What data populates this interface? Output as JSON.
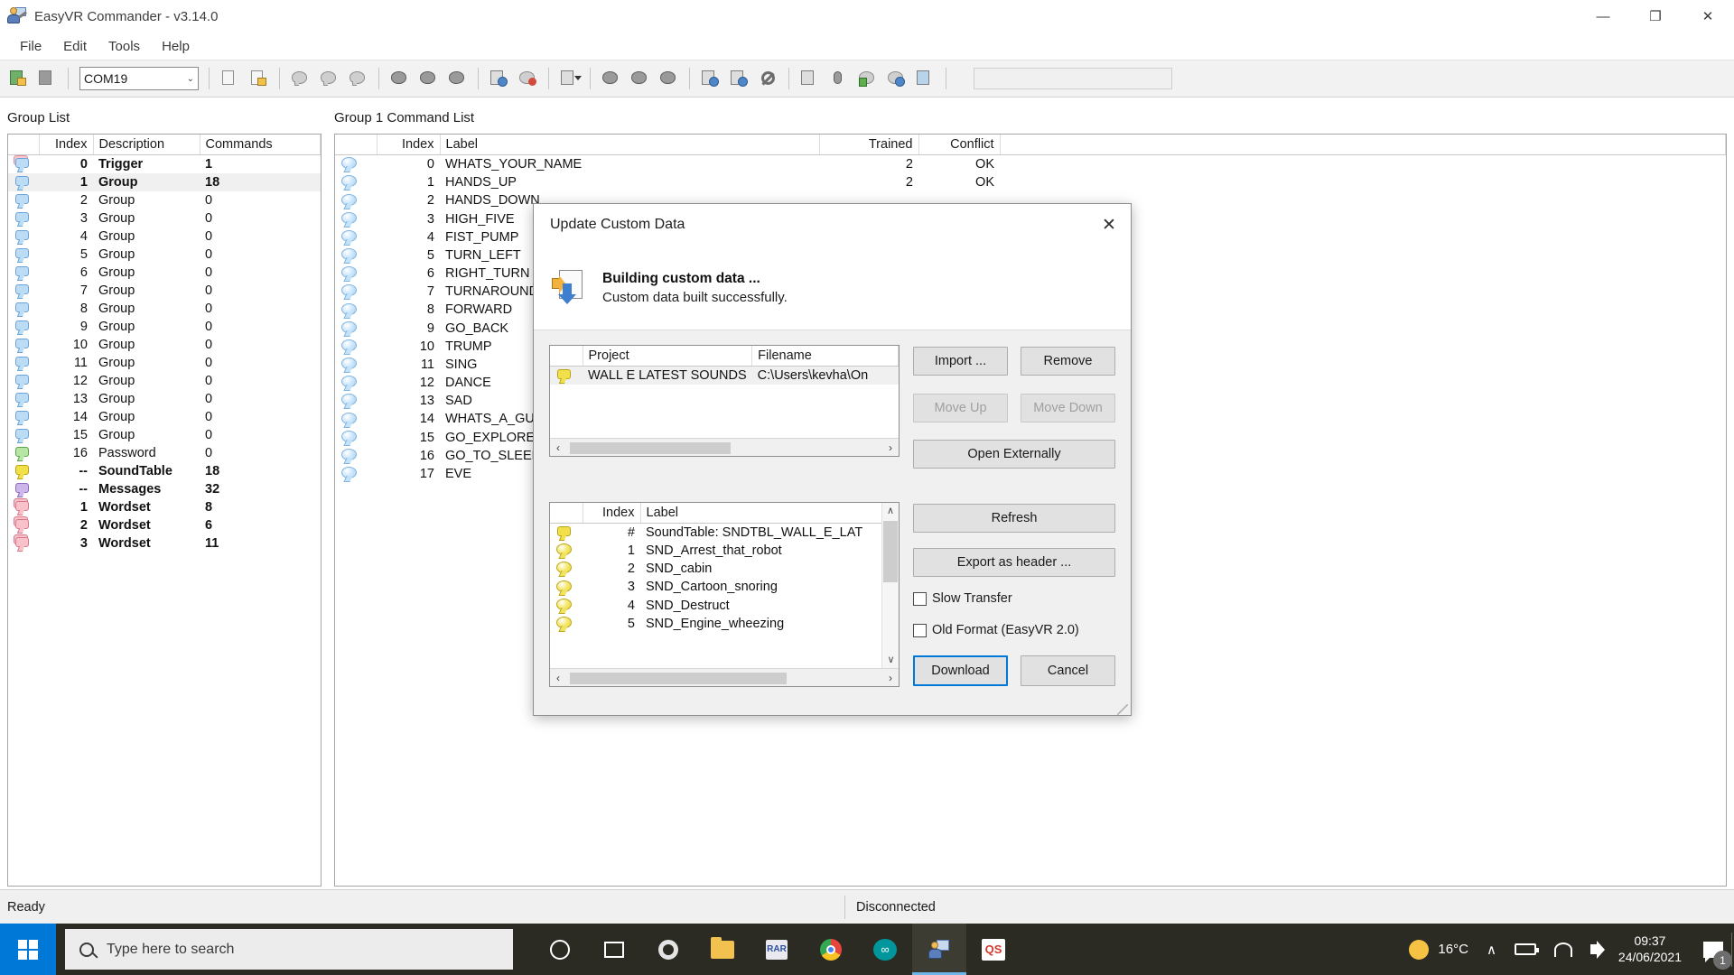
{
  "window": {
    "title": "EasyVR Commander - v3.14.0",
    "icon": "app-icon",
    "minimize": "—",
    "maximize": "❐",
    "close": "✕"
  },
  "menu": {
    "items": [
      "File",
      "Edit",
      "Tools",
      "Help"
    ]
  },
  "toolbar": {
    "port_value": "COM19",
    "port_carat": "⌄",
    "text_field_value": ""
  },
  "group_list": {
    "header": "Group List",
    "columns": [
      "",
      "Index",
      "Description",
      "Commands"
    ],
    "rows": [
      {
        "index": "0",
        "description": "Trigger",
        "commands": "1",
        "icon": "bubble-pink-stack",
        "bold": true,
        "selected": false
      },
      {
        "index": "1",
        "description": "Group",
        "commands": "18",
        "icon": "bubble-blue",
        "bold": true,
        "selected": true
      },
      {
        "index": "2",
        "description": "Group",
        "commands": "0",
        "icon": "bubble-blue",
        "bold": false,
        "selected": false
      },
      {
        "index": "3",
        "description": "Group",
        "commands": "0",
        "icon": "bubble-blue",
        "bold": false,
        "selected": false
      },
      {
        "index": "4",
        "description": "Group",
        "commands": "0",
        "icon": "bubble-blue",
        "bold": false,
        "selected": false
      },
      {
        "index": "5",
        "description": "Group",
        "commands": "0",
        "icon": "bubble-blue",
        "bold": false,
        "selected": false
      },
      {
        "index": "6",
        "description": "Group",
        "commands": "0",
        "icon": "bubble-blue",
        "bold": false,
        "selected": false
      },
      {
        "index": "7",
        "description": "Group",
        "commands": "0",
        "icon": "bubble-blue",
        "bold": false,
        "selected": false
      },
      {
        "index": "8",
        "description": "Group",
        "commands": "0",
        "icon": "bubble-blue",
        "bold": false,
        "selected": false
      },
      {
        "index": "9",
        "description": "Group",
        "commands": "0",
        "icon": "bubble-blue",
        "bold": false,
        "selected": false
      },
      {
        "index": "10",
        "description": "Group",
        "commands": "0",
        "icon": "bubble-blue",
        "bold": false,
        "selected": false
      },
      {
        "index": "11",
        "description": "Group",
        "commands": "0",
        "icon": "bubble-blue",
        "bold": false,
        "selected": false
      },
      {
        "index": "12",
        "description": "Group",
        "commands": "0",
        "icon": "bubble-blue",
        "bold": false,
        "selected": false
      },
      {
        "index": "13",
        "description": "Group",
        "commands": "0",
        "icon": "bubble-blue",
        "bold": false,
        "selected": false
      },
      {
        "index": "14",
        "description": "Group",
        "commands": "0",
        "icon": "bubble-blue",
        "bold": false,
        "selected": false
      },
      {
        "index": "15",
        "description": "Group",
        "commands": "0",
        "icon": "bubble-blue",
        "bold": false,
        "selected": false
      },
      {
        "index": "16",
        "description": "Password",
        "commands": "0",
        "icon": "bubble-green",
        "bold": false,
        "selected": false
      },
      {
        "index": "--",
        "description": "SoundTable",
        "commands": "18",
        "icon": "bubble-yellow",
        "bold": true,
        "selected": false
      },
      {
        "index": "--",
        "description": "Messages",
        "commands": "32",
        "icon": "bubble-purple",
        "bold": true,
        "selected": false
      },
      {
        "index": "1",
        "description": "Wordset",
        "commands": "8",
        "icon": "bubble-pink",
        "bold": true,
        "selected": false
      },
      {
        "index": "2",
        "description": "Wordset",
        "commands": "6",
        "icon": "bubble-pink",
        "bold": true,
        "selected": false
      },
      {
        "index": "3",
        "description": "Wordset",
        "commands": "11",
        "icon": "bubble-pink",
        "bold": true,
        "selected": false
      }
    ]
  },
  "command_list": {
    "header": "Group 1 Command List",
    "columns": [
      "",
      "Index",
      "Label",
      "Trained",
      "Conflict"
    ],
    "rows": [
      {
        "index": "0",
        "label": "WHATS_YOUR_NAME",
        "trained": "2",
        "conflict": "OK"
      },
      {
        "index": "1",
        "label": "HANDS_UP",
        "trained": "2",
        "conflict": "OK"
      },
      {
        "index": "2",
        "label": "HANDS_DOWN",
        "trained": "",
        "conflict": ""
      },
      {
        "index": "3",
        "label": "HIGH_FIVE",
        "trained": "",
        "conflict": ""
      },
      {
        "index": "4",
        "label": "FIST_PUMP",
        "trained": "",
        "conflict": ""
      },
      {
        "index": "5",
        "label": "TURN_LEFT",
        "trained": "",
        "conflict": ""
      },
      {
        "index": "6",
        "label": "RIGHT_TURN",
        "trained": "",
        "conflict": ""
      },
      {
        "index": "7",
        "label": "TURNAROUND",
        "trained": "",
        "conflict": ""
      },
      {
        "index": "8",
        "label": "FORWARD",
        "trained": "",
        "conflict": ""
      },
      {
        "index": "9",
        "label": "GO_BACK",
        "trained": "",
        "conflict": ""
      },
      {
        "index": "10",
        "label": "TRUMP",
        "trained": "",
        "conflict": ""
      },
      {
        "index": "11",
        "label": "SING",
        "trained": "",
        "conflict": ""
      },
      {
        "index": "12",
        "label": "DANCE",
        "trained": "",
        "conflict": ""
      },
      {
        "index": "13",
        "label": "SAD",
        "trained": "",
        "conflict": ""
      },
      {
        "index": "14",
        "label": "WHATS_A_GUY",
        "trained": "",
        "conflict": ""
      },
      {
        "index": "15",
        "label": "GO_EXPLORE",
        "trained": "",
        "conflict": ""
      },
      {
        "index": "16",
        "label": "GO_TO_SLEEP",
        "trained": "",
        "conflict": ""
      },
      {
        "index": "17",
        "label": "EVE",
        "trained": "",
        "conflict": ""
      }
    ]
  },
  "dialog": {
    "title": "Update Custom Data",
    "close_glyph": "✕",
    "status_heading": "Building custom data ...",
    "status_detail": "Custom data built successfully.",
    "project_table": {
      "columns": [
        "",
        "Project",
        "Filename"
      ],
      "rows": [
        {
          "project": "WALL E LATEST SOUNDS",
          "filename": "C:\\Users\\kevha\\On"
        }
      ]
    },
    "sound_table": {
      "columns": [
        "",
        "Index",
        "Label"
      ],
      "rows": [
        {
          "index": "#",
          "label": "SoundTable: SNDTBL_WALL_E_LAT",
          "icon": "bubble-yellow"
        },
        {
          "index": "1",
          "label": "SND_Arrest_that_robot",
          "icon": "oval-yellow"
        },
        {
          "index": "2",
          "label": "SND_cabin",
          "icon": "oval-yellow"
        },
        {
          "index": "3",
          "label": "SND_Cartoon_snoring",
          "icon": "oval-yellow"
        },
        {
          "index": "4",
          "label": "SND_Destruct",
          "icon": "oval-yellow"
        },
        {
          "index": "5",
          "label": "SND_Engine_wheezing",
          "icon": "oval-yellow"
        }
      ]
    },
    "buttons": {
      "import": "Import ...",
      "remove": "Remove",
      "move_up": "Move Up",
      "move_down": "Move Down",
      "open_externally": "Open Externally",
      "refresh": "Refresh",
      "export_as_header": "Export as header ...",
      "download": "Download",
      "cancel": "Cancel"
    },
    "checkboxes": {
      "slow_transfer": "Slow Transfer",
      "old_format": "Old Format (EasyVR 2.0)"
    },
    "scroll_arrows": {
      "left": "‹",
      "right": "›",
      "up": "∧",
      "down": "∨"
    }
  },
  "statusbar": {
    "left": "Ready",
    "right": "Disconnected"
  },
  "taskbar": {
    "search_placeholder": "Type here to search",
    "weather_temp": "16°C",
    "time": "09:37",
    "date": "24/06/2021",
    "notification_count": "1",
    "chevron": "∧"
  }
}
